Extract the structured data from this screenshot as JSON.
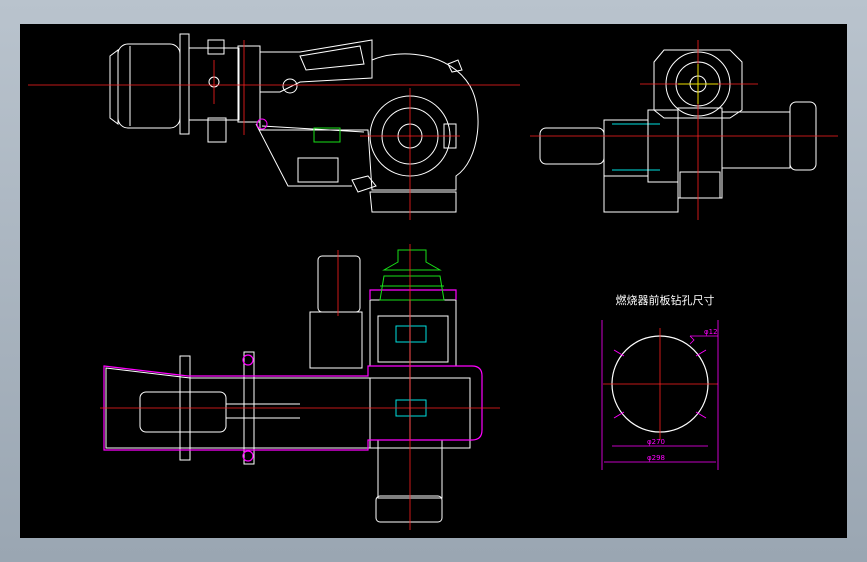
{
  "drawing": {
    "note_title": "燃烧器前板钻孔尺寸",
    "dim_small_hole": "φ12",
    "dim_inner_circle": "φ270",
    "dim_outer_circle": "φ298"
  },
  "colors": {
    "background": "#000000",
    "outline": "#ffffff",
    "centerline": "#ff2020",
    "dimension": "#ff00ff",
    "accent_green": "#18e018",
    "accent_yellow": "#f0e000",
    "accent_cyan": "#00e0e0"
  }
}
